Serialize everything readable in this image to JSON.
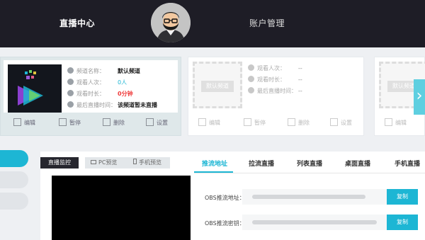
{
  "nav": {
    "live_center": "直播中心",
    "account_mgmt": "账户管理"
  },
  "channel_card": {
    "name_label": "频道名称：",
    "name_value": "默认频道",
    "viewers_label": "观看人次：",
    "viewers_value": "0人",
    "duration_label": "观看时长：",
    "duration_value": "0分钟",
    "last_live_label": "最后直播时间：",
    "last_live_value": "该频道暂未直播"
  },
  "empty_card": {
    "placeholder": "默认频道",
    "viewers_label": "观看人次：",
    "viewers_value": "--",
    "duration_label": "观看时长：",
    "duration_value": "--",
    "last_live_label": "最后直播时间：",
    "last_live_value": "--"
  },
  "actions": {
    "edit": "编辑",
    "pause": "暂停",
    "delete": "删除",
    "settings": "设置"
  },
  "monitor": {
    "button": "直播监控",
    "pc_preview": "PC预览",
    "mobile_preview": "手机预览"
  },
  "stream_tabs": [
    "推流地址",
    "拉流直播",
    "列表直播",
    "桌面直播",
    "手机直播"
  ],
  "obs": {
    "url_label": "OBS推流地址：",
    "key_label": "OBS推流密钥：",
    "copy": "复制"
  },
  "colors": {
    "accent": "#1db6d4",
    "header": "#1e1d26",
    "danger": "#ef3b3b"
  }
}
